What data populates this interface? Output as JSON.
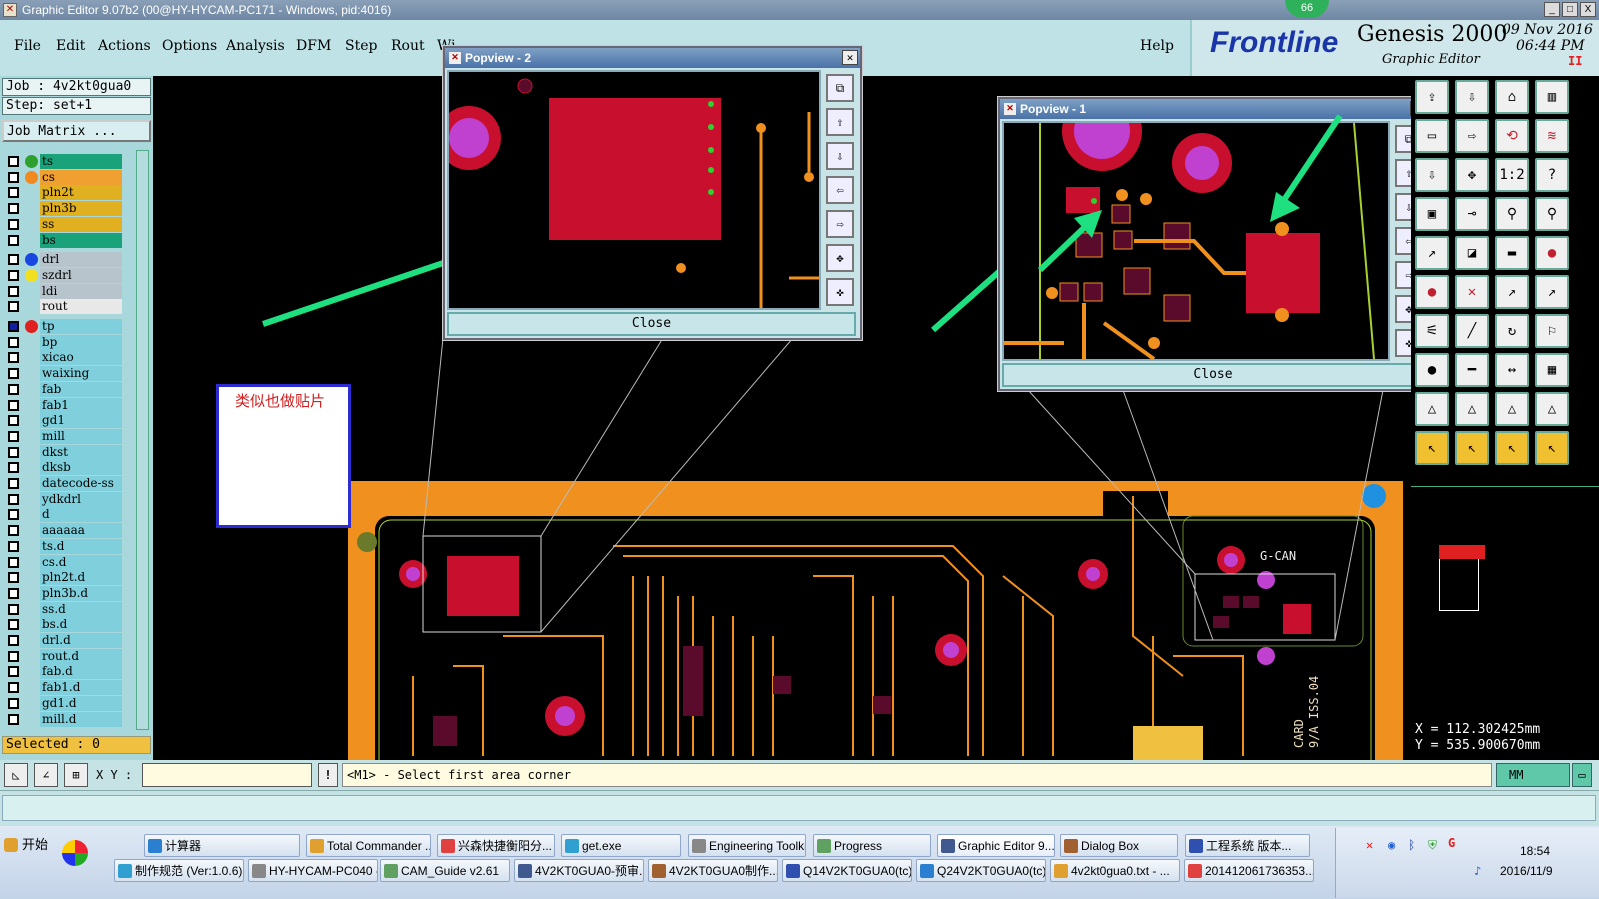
{
  "window": {
    "title": "Graphic Editor 9.07b2 (00@HY-HYCAM-PC171 - Windows, pid:4016)",
    "minimize": "_",
    "maximize": "□",
    "close": "X",
    "badge": "66"
  },
  "menu": {
    "items": [
      "File",
      "Edit",
      "Actions",
      "Options",
      "Analysis",
      "DFM",
      "Step",
      "Rout",
      "Wi"
    ],
    "help": "Help"
  },
  "logo": {
    "brand": "Frontline",
    "product": "Genesis 2000",
    "subtitle": "Graphic Editor",
    "date": "09 Nov 2016",
    "time": "06:44 PM",
    "indicator": "II"
  },
  "job": {
    "job_label": "Job : 4v2kt0gua0",
    "step_label": "Step: set+1",
    "matrix_button": "Job Matrix ..."
  },
  "layers": [
    {
      "name": "ts",
      "bg": "#1aa37a",
      "dot": "#2ea02e"
    },
    {
      "name": "cs",
      "bg": "#f0a030",
      "dot": "#f08a20"
    },
    {
      "name": "pln2t",
      "bg": "#e0b020",
      "dot": ""
    },
    {
      "name": "pln3b",
      "bg": "#e0b020",
      "dot": ""
    },
    {
      "name": "ss",
      "bg": "#e0b020",
      "dot": ""
    },
    {
      "name": "bs",
      "bg": "#1aa37a",
      "dot": ""
    },
    {
      "name": "drl",
      "bg": "#b8c4cc",
      "dot": "#1848e0"
    },
    {
      "name": "szdrl",
      "bg": "#b8c4cc",
      "dot": "#f0e020"
    },
    {
      "name": "ldi",
      "bg": "#b8c4cc",
      "dot": ""
    },
    {
      "name": "rout",
      "bg": "#e8e8e8",
      "dot": ""
    },
    {
      "name": "tp",
      "bg": "#7fd0dc",
      "dot": "#e02020"
    },
    {
      "name": "bp",
      "bg": "#7fd0dc",
      "dot": ""
    },
    {
      "name": "xicao",
      "bg": "#7fd0dc",
      "dot": ""
    },
    {
      "name": "waixing",
      "bg": "#7fd0dc",
      "dot": ""
    },
    {
      "name": "fab",
      "bg": "#7fd0dc",
      "dot": ""
    },
    {
      "name": "fab1",
      "bg": "#7fd0dc",
      "dot": ""
    },
    {
      "name": "gd1",
      "bg": "#7fd0dc",
      "dot": ""
    },
    {
      "name": "mill",
      "bg": "#7fd0dc",
      "dot": ""
    },
    {
      "name": "dkst",
      "bg": "#7fd0dc",
      "dot": ""
    },
    {
      "name": "dksb",
      "bg": "#7fd0dc",
      "dot": ""
    },
    {
      "name": "datecode-ss",
      "bg": "#7fd0dc",
      "dot": ""
    },
    {
      "name": "ydkdrl",
      "bg": "#7fd0dc",
      "dot": ""
    },
    {
      "name": "d",
      "bg": "#7fd0dc",
      "dot": ""
    },
    {
      "name": "aaaaaa",
      "bg": "#7fd0dc",
      "dot": ""
    },
    {
      "name": "ts.d",
      "bg": "#7fd0dc",
      "dot": ""
    },
    {
      "name": "cs.d",
      "bg": "#7fd0dc",
      "dot": ""
    },
    {
      "name": "pln2t.d",
      "bg": "#7fd0dc",
      "dot": ""
    },
    {
      "name": "pln3b.d",
      "bg": "#7fd0dc",
      "dot": ""
    },
    {
      "name": "ss.d",
      "bg": "#7fd0dc",
      "dot": ""
    },
    {
      "name": "bs.d",
      "bg": "#7fd0dc",
      "dot": ""
    },
    {
      "name": "drl.d",
      "bg": "#7fd0dc",
      "dot": ""
    },
    {
      "name": "rout.d",
      "bg": "#7fd0dc",
      "dot": ""
    },
    {
      "name": "fab.d",
      "bg": "#7fd0dc",
      "dot": ""
    },
    {
      "name": "fab1.d",
      "bg": "#7fd0dc",
      "dot": ""
    },
    {
      "name": "gd1.d",
      "bg": "#7fd0dc",
      "dot": ""
    },
    {
      "name": "mill.d",
      "bg": "#7fd0dc",
      "dot": ""
    }
  ],
  "selected_label": "Selected : 0",
  "popview2": {
    "title": "Popview - 2",
    "close_label": "Close"
  },
  "popview1": {
    "title": "Popview - 1",
    "close_label": "Close"
  },
  "note": {
    "text": "类似也做贴片"
  },
  "board": {
    "label1": "G-CAN",
    "label2": "CARD",
    "label3": "9/A ISS.04"
  },
  "coords": {
    "x_label": "X = 112.302425mm",
    "y_label": "Y = 535.900670mm"
  },
  "cmd": {
    "xy_label": "X Y :",
    "xy_value": "",
    "prompt": "<M1> - Select first area corner",
    "unit": "MM",
    "warn": "!"
  },
  "taskbar": {
    "start": "开始",
    "row1": [
      "计算器",
      "Total Commander ...",
      "兴森快捷衡阳分...",
      "get.exe",
      "Engineering Toolki...",
      "Progress",
      "Graphic Editor 9...",
      "Dialog Box",
      "工程系统   版本..."
    ],
    "row2": [
      "制作规范 (Ver:1.0.6)",
      "HY-HYCAM-PC040 -...",
      "CAM_Guide v2.61",
      "4V2KT0GUA0-预审...",
      "4V2KT0GUA0制作...",
      "Q14V2KT0GUA0(tc)...",
      "Q24V2KT0GUA0(tc)...",
      "4v2kt0gua0.txt - ...",
      "201412061736353..."
    ],
    "clock_time": "18:54",
    "clock_date": "2016/11/9"
  },
  "colors": {
    "pad_red": "#c8102e",
    "pad_magenta": "#c040d0",
    "trace_orange": "#f0901e",
    "arrow_green": "#1ee080",
    "bg_panel": "#bfe2e6"
  }
}
